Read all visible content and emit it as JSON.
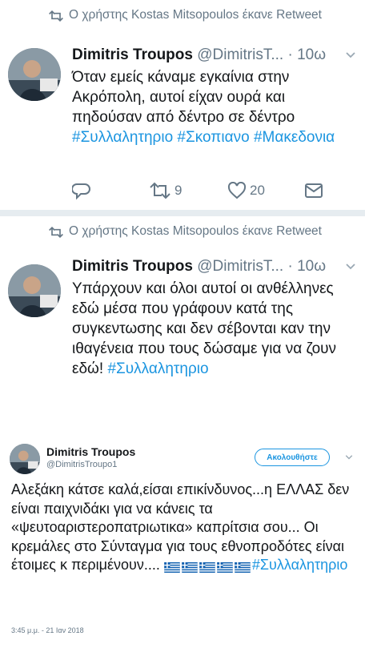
{
  "tweets": [
    {
      "retweet_label": "Ο χρήστης Kostas Mitsopoulos έκανε Retweet",
      "name": "Dimitris Troupos",
      "handle": "@DimitrisT...",
      "time": "· 10ω",
      "text": "Όταν εμείς κάναμε εγκαίνια στην Ακρόπολη, αυτοί είχαν ουρά και πηδούσαν από δέντρο σε δέντρο",
      "hashtags": [
        "#Συλλαλητηριο",
        "#Σκοπιανο",
        "#Μακεδονια"
      ],
      "retweets": "9",
      "likes": "20"
    },
    {
      "retweet_label": "Ο χρήστης Kostas Mitsopoulos έκανε Retweet",
      "name": "Dimitris Troupos",
      "handle": "@DimitrisT...",
      "time": "· 10ω",
      "text": "Υπάρχουν και όλοι αυτοί οι ανθέλληνες εδώ μέσα που γράφουν κατά της συγκεντωσης και δεν σέβονται καν την ιθαγένεια που τους δώσαμε για να ζουν εδώ!",
      "hashtag": "#Συλλαλητηριο"
    }
  ],
  "embed": {
    "name": "Dimitris Troupos",
    "handle": "@DimitrisTroupo1",
    "follow_label": "Ακολουθήστε",
    "text": "Αλεξάκη κάτσε καλά,είσαι επικίνδυνος...η ΕΛΛΑΣ δεν είναι παιχνιδάκι για να κάνεις τα «ψευτοαριστεροπατριωτικα» καπρίτσια σου... Οι κρεμάλες στο Σύνταγμα για τους εθνοπροδότες είναι έτοιμες κ περιμένουν....",
    "hashtag": "#Συλλαλητηριο",
    "flag_count": 5,
    "timestamp": "3:45 μ.μ. - 21 Ιαν 2018"
  },
  "colors": {
    "link": "#1b95e0",
    "secondary": "#657786",
    "divider": "#e6ecf0",
    "flag_blue": "#0d5eaf"
  },
  "icons": [
    "retweet-icon",
    "chevron-down-icon",
    "reply-icon",
    "like-icon",
    "direct-message-icon",
    "greek-flag-icon"
  ]
}
